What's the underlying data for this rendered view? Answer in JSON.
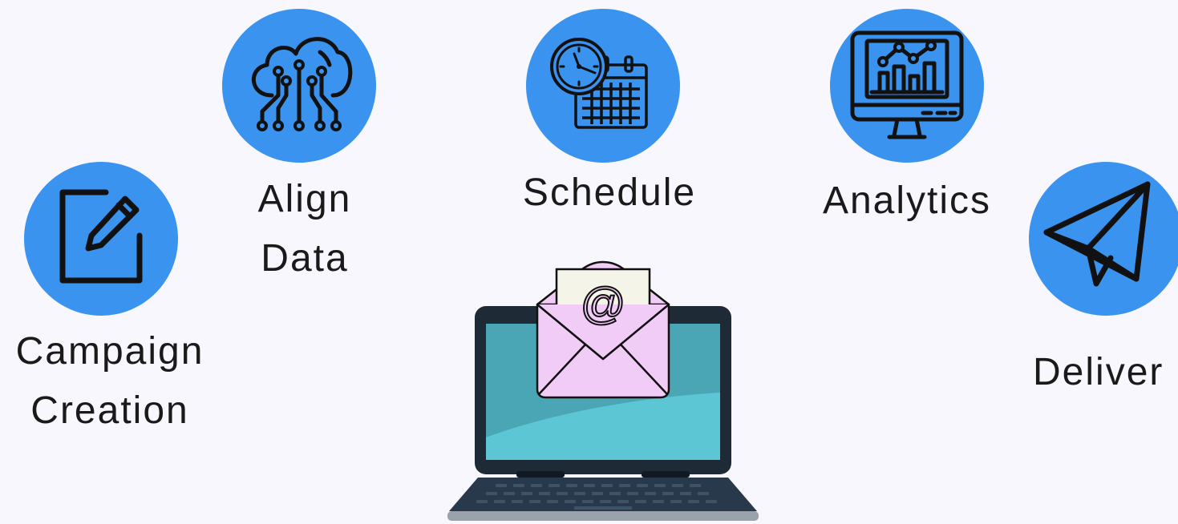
{
  "steps": [
    {
      "id": "campaign",
      "lines": [
        "Campaign",
        "Creation"
      ],
      "icon": "edit-icon"
    },
    {
      "id": "align",
      "lines": [
        "Align",
        "Data"
      ],
      "icon": "cloud-network-icon"
    },
    {
      "id": "schedule",
      "lines": [
        "Schedule"
      ],
      "icon": "clock-calendar-icon"
    },
    {
      "id": "analytics",
      "lines": [
        "Analytics"
      ],
      "icon": "monitor-chart-icon"
    },
    {
      "id": "deliver",
      "lines": [
        "Deliver"
      ],
      "icon": "paper-plane-icon"
    }
  ],
  "center": {
    "icon": "laptop-email-icon",
    "envelope_symbol": "@"
  },
  "colors": {
    "background": "#f7f7fd",
    "circle": "#3a93ef",
    "icon_stroke": "#111111",
    "text": "#1a1a1a",
    "laptop_frame": "#1e2b36",
    "screen": "#5cc6d5",
    "envelope": "#f1ccf7",
    "letter": "#f5f4e8"
  }
}
